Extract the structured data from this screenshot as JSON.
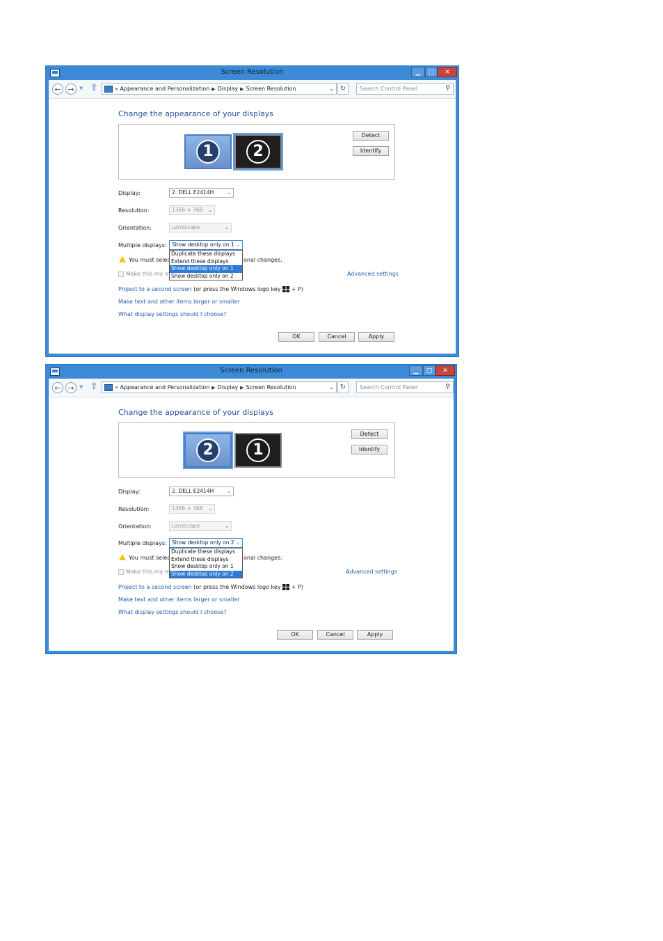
{
  "windows": [
    {
      "title": "Screen Resolution",
      "breadcrumb": [
        "Appearance and Personalization",
        "Display",
        "Screen Resolution"
      ],
      "breadcrumb_prefix": "«",
      "search_placeholder": "Search Control Panel",
      "heading": "Change the appearance of your displays",
      "monitors": [
        {
          "number": "1",
          "style": "light"
        },
        {
          "number": "2",
          "style": "dark"
        }
      ],
      "detect_label": "Detect",
      "identify_label": "Identify",
      "display_label": "Display:",
      "display_value": "2. DELL E2414H",
      "resolution_label": "Resolution:",
      "resolution_value": "1366 × 768",
      "orientation_label": "Orientation:",
      "orientation_value": "Landscape",
      "multiple_label": "Multiple displays:",
      "multiple_value": "Show desktop only on 1",
      "dropdown_options": [
        "Duplicate these displays",
        "Extend these displays",
        "Show desktop only on 1",
        "Show desktop only on 2"
      ],
      "dropdown_selected": 2,
      "warning_prefix": "You must selec",
      "warning_suffix": "onal changes.",
      "checkbox_prefix": "Make this my m",
      "advanced_link": "Advanced settings",
      "project_link": "Project to a second screen",
      "project_rest": " (or press the Windows logo key ",
      "project_end": " + P)",
      "text_link": "Make text and other items larger or smaller",
      "help_link": "What display settings should I choose?",
      "ok_label": "OK",
      "cancel_label": "Cancel",
      "apply_label": "Apply"
    },
    {
      "title": "Screen Resolution",
      "breadcrumb": [
        "Appearance and Personalization",
        "Display",
        "Screen Resolution"
      ],
      "breadcrumb_prefix": "«",
      "search_placeholder": "Search Control Panel",
      "heading": "Change the appearance of your displays",
      "monitors": [
        {
          "number": "2",
          "style": "light"
        },
        {
          "number": "1",
          "style": "dark"
        }
      ],
      "detect_label": "Detect",
      "identify_label": "Identify",
      "display_label": "Display:",
      "display_value": "2. DELL E2414H",
      "resolution_label": "Resolution:",
      "resolution_value": "1366 × 768",
      "orientation_label": "Orientation:",
      "orientation_value": "Landscape",
      "multiple_label": "Multiple displays:",
      "multiple_value": "Show desktop only on 2",
      "dropdown_options": [
        "Duplicate these displays",
        "Extend these displays",
        "Show desktop only on 1",
        "Show desktop only on 2"
      ],
      "dropdown_selected": 3,
      "warning_prefix": "You must selec",
      "warning_suffix": "onal changes.",
      "checkbox_prefix": "Make this my m",
      "advanced_link": "Advanced settings",
      "project_link": "Project to a second screen",
      "project_rest": " (or press the Windows logo key ",
      "project_end": " + P)",
      "text_link": "Make text and other items larger or smaller",
      "help_link": "What display settings should I choose?",
      "ok_label": "OK",
      "cancel_label": "Cancel",
      "apply_label": "Apply"
    }
  ]
}
